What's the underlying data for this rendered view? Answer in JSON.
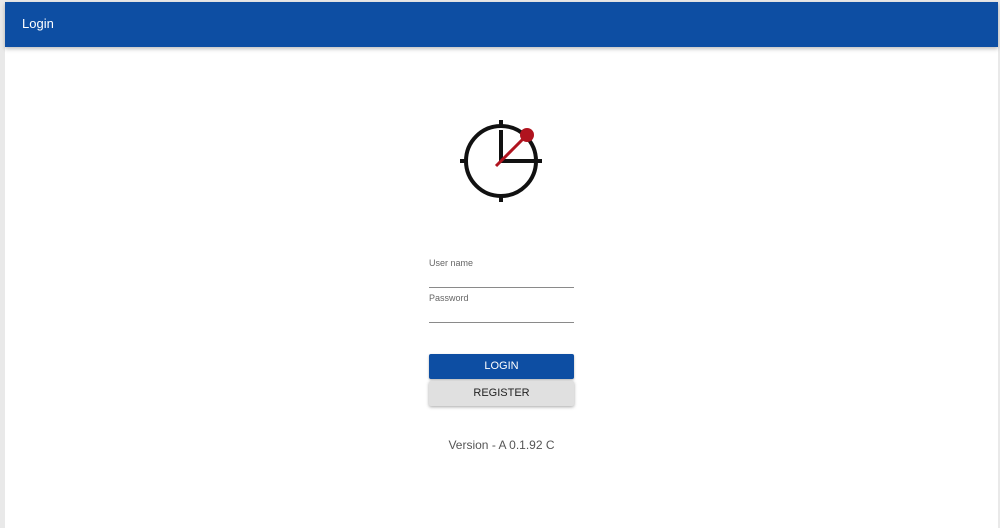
{
  "appbar": {
    "title": "Login",
    "color": "#0d4ea3"
  },
  "logo": {
    "icon": "clock-crosshair-icon",
    "accent_color": "#b0131e"
  },
  "form": {
    "username": {
      "label": "User name",
      "value": ""
    },
    "password": {
      "label": "Password",
      "value": ""
    }
  },
  "buttons": {
    "login_label": "LOGIN",
    "register_label": "REGISTER"
  },
  "version_text": "Version - A 0.1.92 C"
}
